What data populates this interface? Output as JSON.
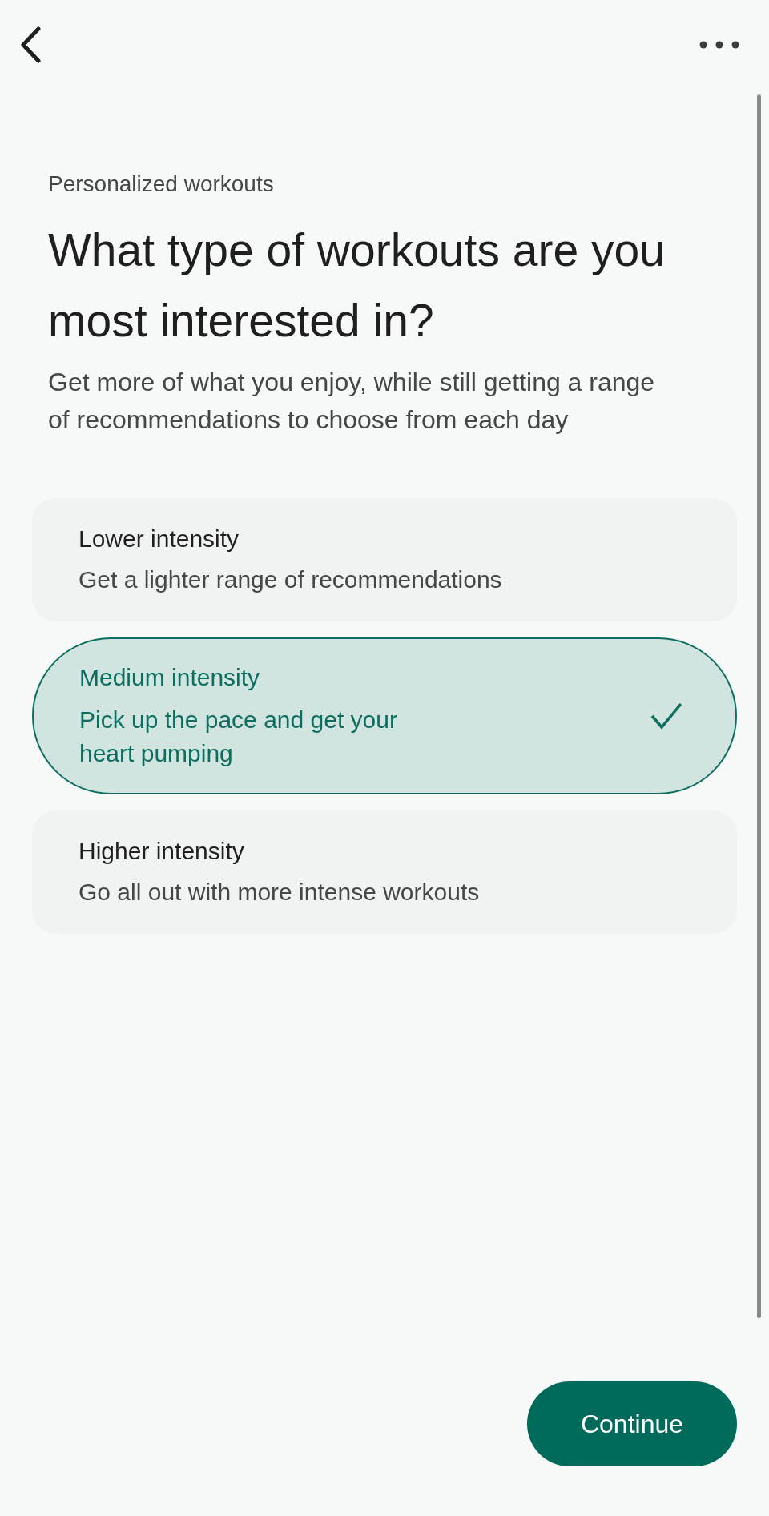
{
  "header": {
    "eyebrow": "Personalized workouts",
    "title": "What type of workouts are you most interested in?",
    "subtitle": "Get more of what you enjoy, while still getting a range of recommendations to choose from each day"
  },
  "options": [
    {
      "title": "Lower intensity",
      "description": "Get a lighter range of recommendations",
      "selected": false
    },
    {
      "title": "Medium intensity",
      "description": "Pick up the pace and get your heart pumping",
      "selected": true
    },
    {
      "title": "Higher intensity",
      "description": "Go all out with more intense workouts",
      "selected": false
    }
  ],
  "continue_button": "Continue"
}
